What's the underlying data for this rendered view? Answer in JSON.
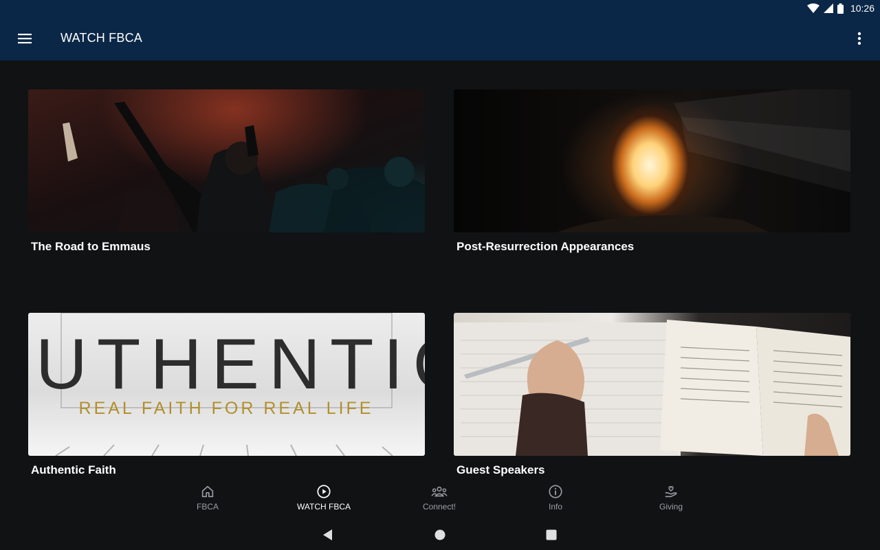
{
  "status_bar": {
    "time": "10:26"
  },
  "app_bar": {
    "title": "WATCH FBCA"
  },
  "cards": [
    {
      "title": "The Road to Emmaus"
    },
    {
      "title": "Post-Resurrection Appearances"
    },
    {
      "title": "Authentic Faith",
      "image_text": {
        "headline": "AUTHENTIC",
        "tagline": "REAL FAITH FOR REAL LIFE"
      }
    },
    {
      "title": "Guest Speakers"
    }
  ],
  "bottom_nav": {
    "items": [
      {
        "label": "FBCA",
        "icon": "home-icon",
        "active": false
      },
      {
        "label": "WATCH FBCA",
        "icon": "play-circle-icon",
        "active": true
      },
      {
        "label": "Connect!",
        "icon": "group-icon",
        "active": false
      },
      {
        "label": "Info",
        "icon": "info-icon",
        "active": false
      },
      {
        "label": "Giving",
        "icon": "giving-hand-icon",
        "active": false
      }
    ],
    "active_color": "#ffffff",
    "inactive_color": "#9aa0a6"
  }
}
